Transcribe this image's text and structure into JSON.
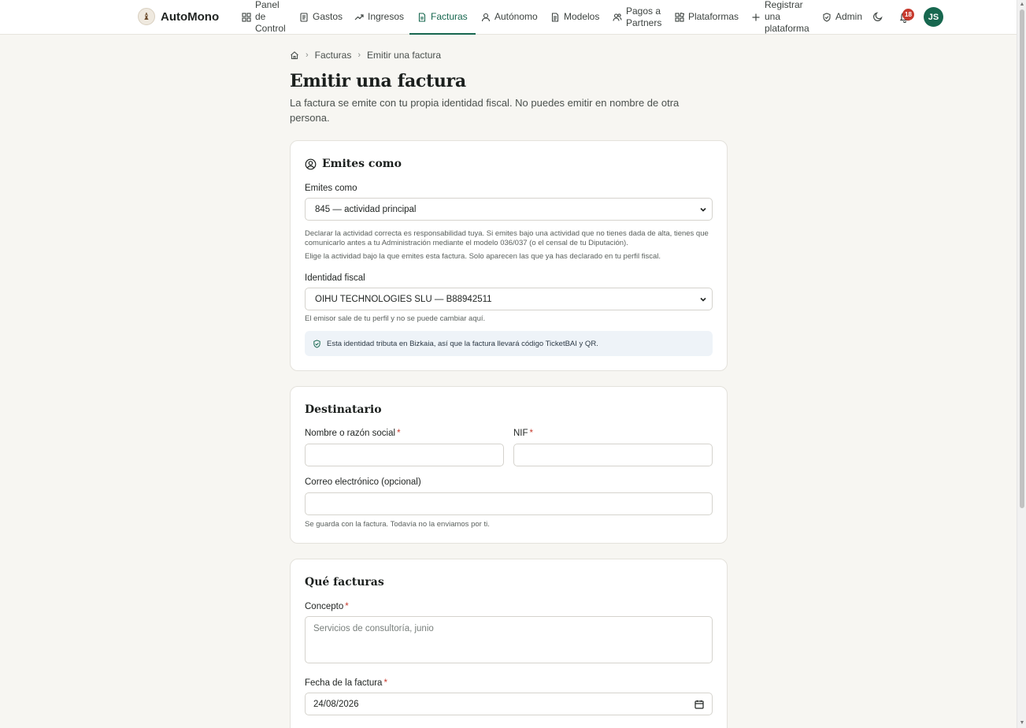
{
  "brand": {
    "name": "AutoMono",
    "logo_glyph": "♝"
  },
  "nav": [
    {
      "lines": [
        "Panel",
        "de",
        "Control"
      ],
      "icon": "dashboard-icon"
    },
    {
      "lines": [
        "Gastos"
      ],
      "icon": "receipt-icon"
    },
    {
      "lines": [
        "Ingresos"
      ],
      "icon": "trending-up-icon"
    },
    {
      "lines": [
        "Facturas"
      ],
      "icon": "invoice-icon",
      "active": true
    },
    {
      "lines": [
        "Autónomo"
      ],
      "icon": "user-icon"
    },
    {
      "lines": [
        "Modelos"
      ],
      "icon": "document-icon"
    },
    {
      "lines": [
        "Pagos a",
        "Partners"
      ],
      "icon": "users-icon"
    },
    {
      "lines": [
        "Plataformas"
      ],
      "icon": "apps-icon"
    },
    {
      "lines": [
        "Registrar",
        "una",
        "plataforma"
      ],
      "icon": "plus-icon"
    },
    {
      "lines": [
        "Admin"
      ],
      "icon": "shield-icon"
    }
  ],
  "header": {
    "notifications_count": "18",
    "avatar_initials": "JS"
  },
  "breadcrumb": {
    "section": "Facturas",
    "current": "Emitir una factura"
  },
  "page": {
    "title": "Emitir una factura",
    "subtitle": "La factura se emite con tu propia identidad fiscal. No puedes emitir en nombre de otra persona."
  },
  "emitter_card": {
    "title": "Emites como",
    "activity_label": "Emites como",
    "activity_value": "845 — actividad principal",
    "activity_help_1": "Declarar la actividad correcta es responsabilidad tuya. Si emites bajo una actividad que no tienes dada de alta, tienes que comunicarlo antes a tu Administración mediante el modelo 036/037 (o el censal de tu Diputación).",
    "activity_help_2": "Elige la actividad bajo la que emites esta factura. Solo aparecen las que ya has declarado en tu perfil fiscal.",
    "identity_label": "Identidad fiscal",
    "identity_value": "OIHU TECHNOLOGIES SLU — B88942511",
    "identity_help": "El emisor sale de tu perfil y no se puede cambiar aquí.",
    "info_text": "Esta identidad tributa en Bizkaia, así que la factura llevará código TicketBAI y QR."
  },
  "recipient_card": {
    "title": "Destinatario",
    "name_label": "Nombre o razón social",
    "name_value": "",
    "nif_label": "NIF",
    "nif_value": "",
    "email_label": "Correo electrónico (opcional)",
    "email_value": "",
    "email_help": "Se guarda con la factura. Todavía no la enviamos por ti.",
    "required_mark": "*"
  },
  "items_card": {
    "title": "Qué facturas",
    "concept_label": "Concepto",
    "concept_placeholder": "Servicios de consultoría, junio",
    "date_label": "Fecha de la factura",
    "date_value": "24/08/2026"
  }
}
